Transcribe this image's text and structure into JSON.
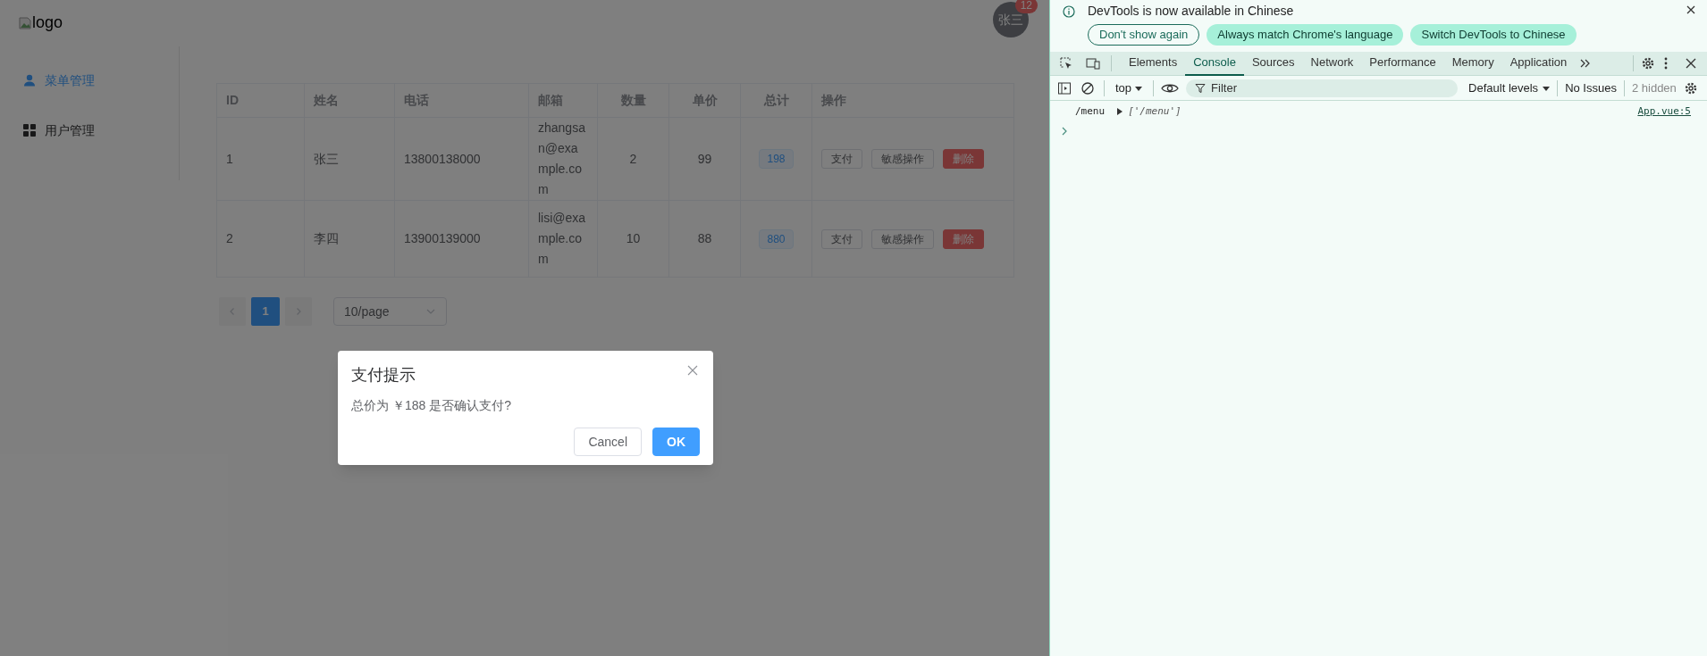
{
  "app": {
    "logo": "logo",
    "avatar": {
      "text": "张三",
      "badge": "12"
    },
    "sidebar": [
      {
        "label": "菜单管理",
        "selected": true,
        "kind": "user"
      },
      {
        "label": "用户管理",
        "selected": false,
        "kind": "grid"
      }
    ],
    "table": {
      "columns": [
        "ID",
        "姓名",
        "电话",
        "邮箱",
        "数量",
        "单价",
        "总计",
        "操作"
      ],
      "rows": [
        {
          "id": "1",
          "name": "张三",
          "phone": "13800138000",
          "email": "zhangsan@example.com",
          "quantity": "2",
          "price": "99",
          "total": "198",
          "actions": [
            {
              "label": "支付",
              "kind": "default"
            },
            {
              "label": "敏感操作",
              "kind": "default"
            },
            {
              "label": "删除",
              "kind": "danger"
            }
          ]
        },
        {
          "id": "2",
          "name": "李四",
          "phone": "13900139000",
          "email": "lisi@example.com",
          "quantity": "10",
          "price": "88",
          "total": "880",
          "actions": [
            {
              "label": "支付",
              "kind": "default"
            },
            {
              "label": "敏感操作",
              "kind": "default"
            },
            {
              "label": "删除",
              "kind": "danger"
            }
          ]
        }
      ]
    },
    "pagination": {
      "pages": [
        {
          "label": "1",
          "selected": true
        }
      ],
      "page_size": "10/page"
    },
    "dialog": {
      "title": "支付提示",
      "message": "总价为 ￥188 是否确认支付?",
      "buttons": [
        {
          "label": "Cancel",
          "kind": "default"
        },
        {
          "label": "OK",
          "kind": "primary"
        }
      ]
    }
  },
  "devtools": {
    "infobar": {
      "message": "DevTools is now available in Chinese",
      "buttons": [
        {
          "label": "Don't show again",
          "kind": "outline"
        },
        {
          "label": "Always match Chrome's language",
          "kind": "filled"
        },
        {
          "label": "Switch DevTools to Chinese",
          "kind": "filled"
        }
      ]
    },
    "tabs": [
      {
        "label": "Elements",
        "selected": false
      },
      {
        "label": "Console",
        "selected": true
      },
      {
        "label": "Sources",
        "selected": false
      },
      {
        "label": "Network",
        "selected": false
      },
      {
        "label": "Performance",
        "selected": false
      },
      {
        "label": "Memory",
        "selected": false
      },
      {
        "label": "Application",
        "selected": false
      }
    ],
    "context": "top",
    "filter": {
      "placeholder": "Filter"
    },
    "levels": "Default levels",
    "issues": "No Issues",
    "hidden": "2 hidden",
    "console": [
      {
        "text": "/menu",
        "value": "['/menu']",
        "source": "App.vue:5"
      }
    ]
  }
}
